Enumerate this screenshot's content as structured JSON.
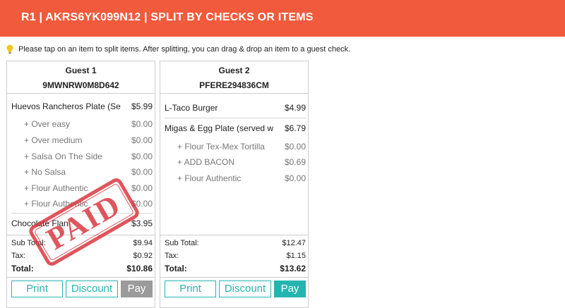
{
  "header": {
    "title": "R1 | AKRS6YK099N12 | SPLIT BY CHECKS OR ITEMS",
    "color": "#f15a3c"
  },
  "hint": {
    "icon": "lightbulb-icon",
    "text": "Please tap on an item to split items. After splitting, you can drag & drop an item to a guest check."
  },
  "guests": [
    {
      "name": "Guest 1",
      "code": "9MWNRW0M8D642",
      "paid": true,
      "stamp_text": "PAID",
      "items": [
        {
          "name": "Huevos Rancheros Plate (Se",
          "price": "$5.99"
        },
        {
          "name": "+ Over easy",
          "price": "$0.00"
        },
        {
          "name": "+ Over medium",
          "price": "$0.00"
        },
        {
          "name": "+ Salsa On The Side",
          "price": "$0.00"
        },
        {
          "name": "+ No Salsa",
          "price": "$0.00"
        },
        {
          "name": "+ Flour Authentic",
          "price": "$0.00"
        },
        {
          "name": "+ Flour Authentic",
          "price": "$0.00"
        },
        {
          "name": "Chocolate Flan",
          "price": "$3.95"
        }
      ],
      "subtotal_label": "Sub Total:",
      "subtotal": "$9.94",
      "tax_label": "Tax:",
      "tax": "$0.92",
      "total_label": "Total:",
      "total": "$10.86",
      "buttons": {
        "print": "Print",
        "discount": "Discount",
        "pay": "Pay"
      }
    },
    {
      "name": "Guest 2",
      "code": "PFERE294836CM",
      "paid": false,
      "items": [
        {
          "name": "L-Taco Burger",
          "price": "$4.99"
        },
        {
          "name": "Migas & Egg Plate (served w",
          "price": "$6.79"
        },
        {
          "name": "+ Flour Tex-Mex Tortilla",
          "price": "$0.00"
        },
        {
          "name": "+ ADD BACON",
          "price": "$0.69"
        },
        {
          "name": "+ Flour Authentic",
          "price": "$0.00"
        }
      ],
      "subtotal_label": "Sub Total:",
      "subtotal": "$12.47",
      "tax_label": "Tax:",
      "tax": "$1.15",
      "total_label": "Total:",
      "total": "$13.62",
      "buttons": {
        "print": "Print",
        "discount": "Discount",
        "pay": "Pay"
      }
    }
  ],
  "colors": {
    "accent": "#25b5b1",
    "disabled": "#9b9b9b",
    "stamp": "#d8323a"
  }
}
